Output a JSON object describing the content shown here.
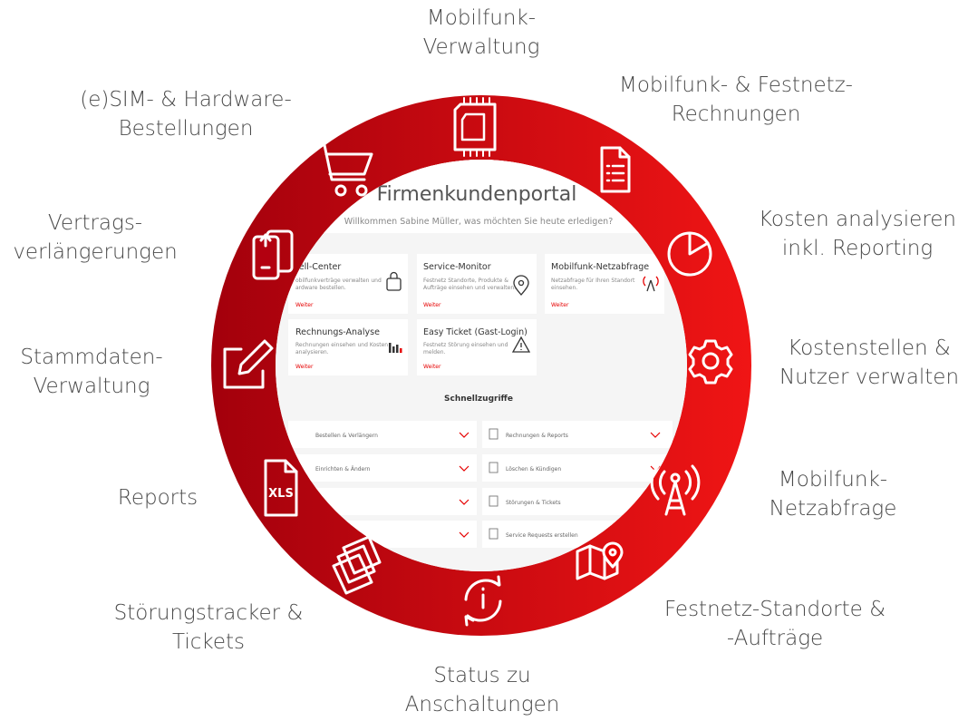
{
  "colors": {
    "ring_dark": "#a8000a",
    "ring_light": "#ee1111",
    "icon": "#ffffff",
    "label": "#4a4a4a",
    "accent": "#e60000"
  },
  "labels": {
    "mobilfunk_verwaltung": [
      "Mobilfunk-",
      "Verwaltung"
    ],
    "rechnungen": [
      "Mobilfunk- & Festnetz-",
      "Rechnungen"
    ],
    "kosten": [
      "Kosten analysieren",
      "inkl. Reporting"
    ],
    "kostenstellen": [
      "Kostenstellen &",
      "Nutzer verwalten"
    ],
    "netzabfrage": [
      "Mobilfunk-",
      "Netzabfrage"
    ],
    "festnetz": [
      "Festnetz-Standorte &",
      "-Aufträge"
    ],
    "status": [
      "Status zu",
      "Anschaltungen"
    ],
    "stoerung": [
      "Störungstracker &",
      "Tickets"
    ],
    "reports": [
      "Reports"
    ],
    "stammdaten": [
      "Stammdaten-",
      "Verwaltung"
    ],
    "vertrag": [
      "Vertrags-",
      "verlängerungen"
    ],
    "sim": [
      "(e)SIM- & Hardware-",
      "Bestellungen"
    ]
  },
  "icons": [
    "sim-card-icon",
    "invoice-icon",
    "pie-chart-icon",
    "gear-icon",
    "antenna-icon",
    "map-pin-icon",
    "refresh-info-icon",
    "tickets-icon",
    "xls-file-icon",
    "edit-icon",
    "phone-upgrade-icon",
    "shopping-cart-icon"
  ],
  "portal": {
    "title": "Firmenkundenportal",
    "subtitle": "Willkommen Sabine Müller, was möchten Sie heute erledigen?",
    "cards": [
      {
        "title": "tell-Center",
        "desc1": "obilfunkverträge verwalten und",
        "desc2": "ardware bestellen.",
        "link": "Weiter",
        "icon": "bag-icon"
      },
      {
        "title": "Service-Monitor",
        "desc1": "Festnetz Standorte, Produkte &",
        "desc2": "Aufträge einsehen und verwalten.",
        "link": "Weiter",
        "icon": "location-icon"
      },
      {
        "title": "Mobilfunk-Netzabfrage",
        "desc1": "Netzabfrage für Ihren Standort",
        "desc2": "einsehen.",
        "link": "Weiter",
        "icon": "antenna-icon"
      },
      {
        "title": "Rechnungs-Analyse",
        "desc1": "Rechnungen einsehen und Kosten",
        "desc2": "analysieren.",
        "link": "Weiter",
        "icon": "bar-chart-icon"
      },
      {
        "title": "Easy Ticket (Gast-Login)",
        "desc1": "Festnetz Störung einsehen und",
        "desc2": "melden.",
        "link": "Weiter",
        "icon": "warning-icon"
      }
    ],
    "quick_title": "Schnellzugriffe",
    "quick_left": [
      "Bestellen & Verlängern",
      "Einrichten & Ändern",
      "",
      ""
    ],
    "quick_right": [
      "Rechnungen & Reports",
      "Löschen & Kündigen",
      "Störungen & Tickets",
      "Service Requests erstellen"
    ]
  }
}
